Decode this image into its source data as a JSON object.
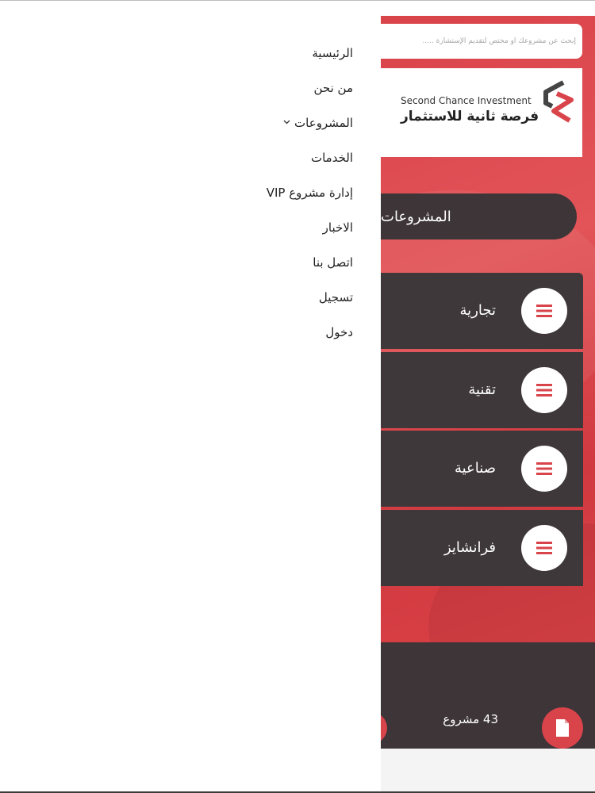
{
  "menu": {
    "items": [
      {
        "label": "الرئيسية"
      },
      {
        "label": "من نحن"
      },
      {
        "label": "المشروعات",
        "has_dropdown": true
      },
      {
        "label": "الخدمات"
      },
      {
        "label": "إدارة مشروع VIP"
      },
      {
        "label": "الاخبار"
      },
      {
        "label": "اتصل بنا"
      },
      {
        "label": "تسجيل"
      },
      {
        "label": "دخول"
      }
    ]
  },
  "search": {
    "placeholder": "إبحث عن مشروعك أو مختص لتقديم الإستشارة ....."
  },
  "brand": {
    "name_en": "Second Chance Investment",
    "name_ar": "فرصة ثانية للاستثمار",
    "accent": "#d9434a",
    "dark": "#3d3538"
  },
  "section": {
    "title": "المشروعات"
  },
  "categories": [
    {
      "label": "تجارية",
      "icon": "hamburger-icon"
    },
    {
      "label": "تقنية",
      "icon": "hamburger-icon"
    },
    {
      "label": "صناعية",
      "icon": "hamburger-icon"
    },
    {
      "label": "فرانشايز",
      "icon": "hamburger-icon"
    }
  ],
  "stats": {
    "projects_count": "43 مشروع",
    "icon": "document-icon"
  }
}
